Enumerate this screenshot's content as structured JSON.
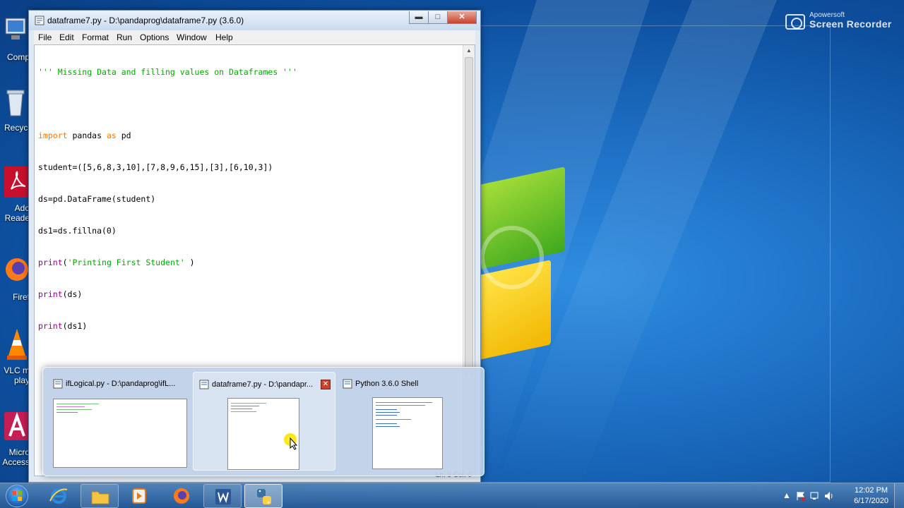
{
  "recorder": {
    "brand": "Apowersoft",
    "product": "Screen Recorder"
  },
  "desktop_icons": [
    {
      "label": "Comp"
    },
    {
      "label": "Recycl"
    },
    {
      "label1": "Ado",
      "label2": "Reade"
    },
    {
      "label": "Firef"
    },
    {
      "label1": "VLC m",
      "label2": "play"
    },
    {
      "label1": "Micro",
      "label2": "Access"
    }
  ],
  "window": {
    "title": "dataframe7.py - D:\\pandaprog\\dataframe7.py (3.6.0)",
    "minimize": "▬",
    "maximize": "□",
    "close": "✕",
    "menu": [
      "File",
      "Edit",
      "Format",
      "Run",
      "Options",
      "Window",
      "Help"
    ],
    "status": "Ln: 9   Col: 0"
  },
  "code": {
    "l1": "''' Missing Data and filling values on Dataframes '''",
    "l3_kw1": "import",
    "l3_mid": " pandas ",
    "l3_kw2": "as",
    "l3_end": " pd",
    "l4": "student=([5,6,8,3,10],[7,8,9,6,15],[3],[6,10,3])",
    "l5": "ds=pd.DataFrame(student)",
    "l6": "ds1=ds.fillna(0)",
    "l7_bi": "print",
    "l7_a": "(",
    "l7_str": "'Printing First Student'",
    "l7_b": " )",
    "l8_bi": "print",
    "l8_rest": "(ds)",
    "l9_bi": "print",
    "l9_rest": "(ds1)"
  },
  "thumbnails": [
    {
      "title": "ifLogical.py - D:\\pandaprog\\ifL..."
    },
    {
      "title": "dataframe7.py - D:\\pandapr...",
      "close": "✕"
    },
    {
      "title": "Python 3.6.0 Shell"
    }
  ],
  "taskbar": {
    "pinned": [
      "internet-explorer",
      "file-explorer",
      "media-player",
      "firefox",
      "word",
      "python-idle"
    ]
  },
  "clock": {
    "time": "12:02 PM",
    "date": "6/17/2020"
  },
  "colors": {
    "keyword": "#ff7700",
    "string": "#00aa00",
    "builtin": "#900090"
  }
}
